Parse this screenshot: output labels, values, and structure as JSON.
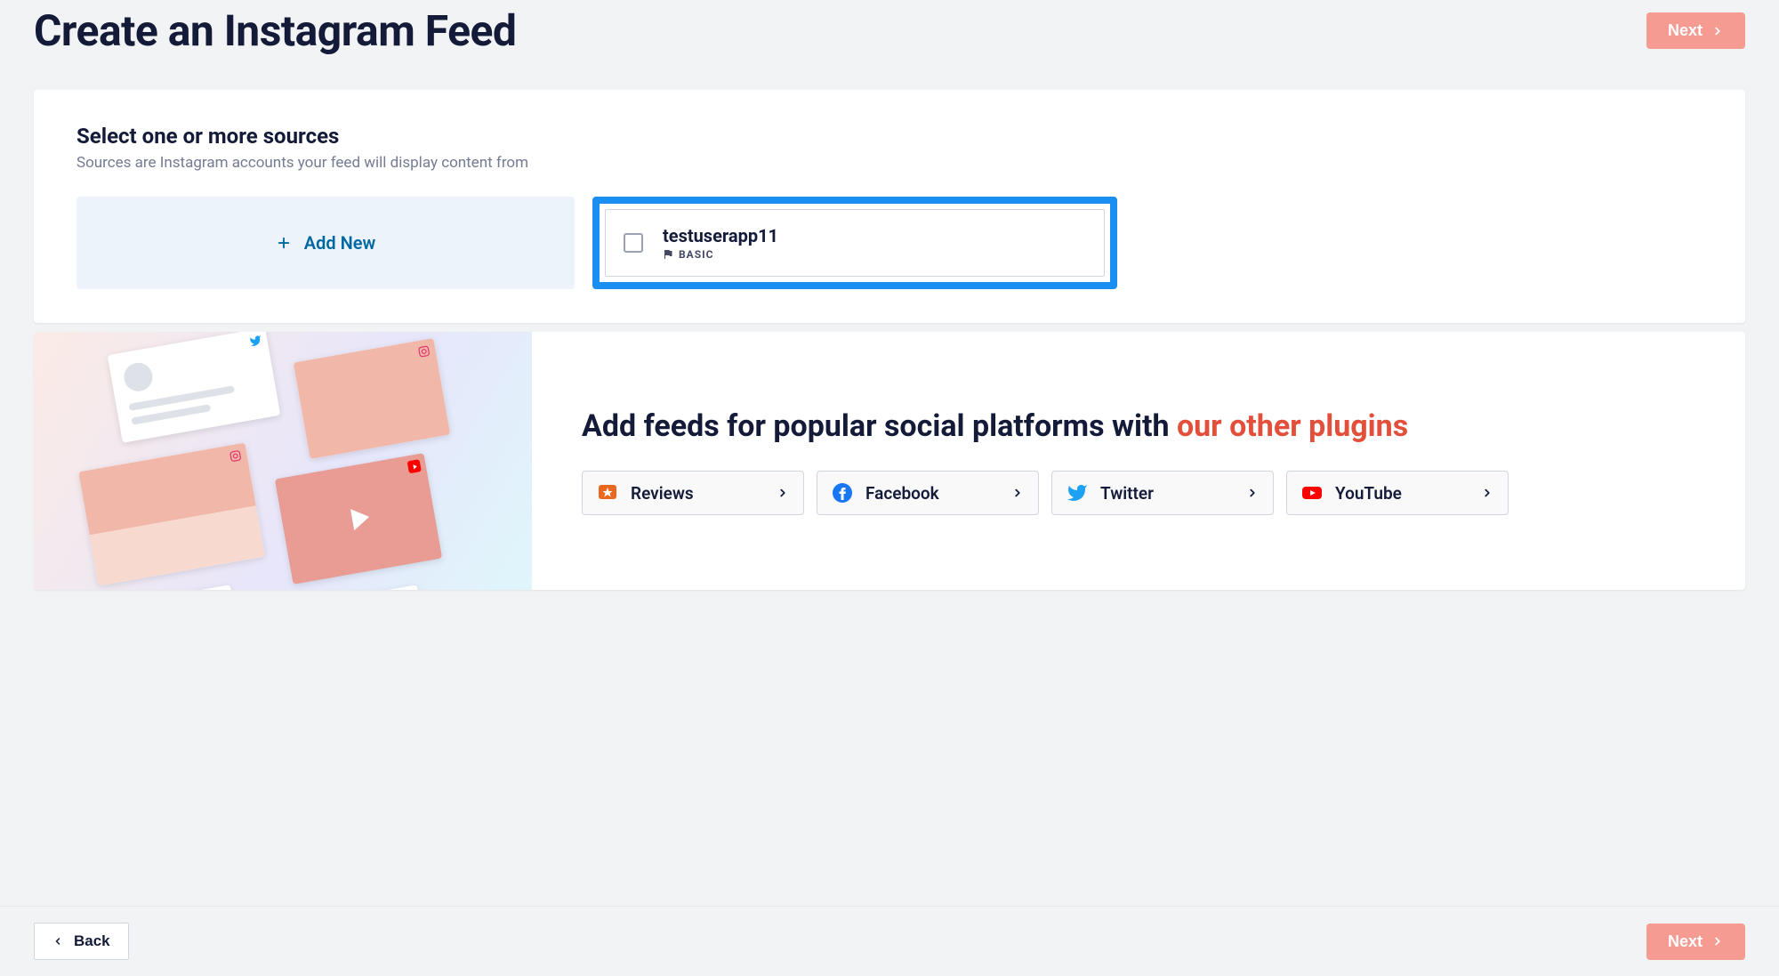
{
  "header": {
    "title": "Create an Instagram Feed",
    "next": "Next"
  },
  "sources": {
    "title": "Select one or more sources",
    "subtitle": "Sources are Instagram accounts your feed will display content from",
    "add_new": "Add New",
    "items": [
      {
        "name": "testuserapp11",
        "tier": "BASIC",
        "checked": false
      }
    ]
  },
  "promo": {
    "title_pre": "Add feeds for popular social platforms with ",
    "title_accent": "our other plugins",
    "plugins": [
      {
        "key": "reviews",
        "label": "Reviews"
      },
      {
        "key": "facebook",
        "label": "Facebook"
      },
      {
        "key": "twitter",
        "label": "Twitter"
      },
      {
        "key": "youtube",
        "label": "YouTube"
      }
    ]
  },
  "footer": {
    "back": "Back",
    "next": "Next"
  }
}
